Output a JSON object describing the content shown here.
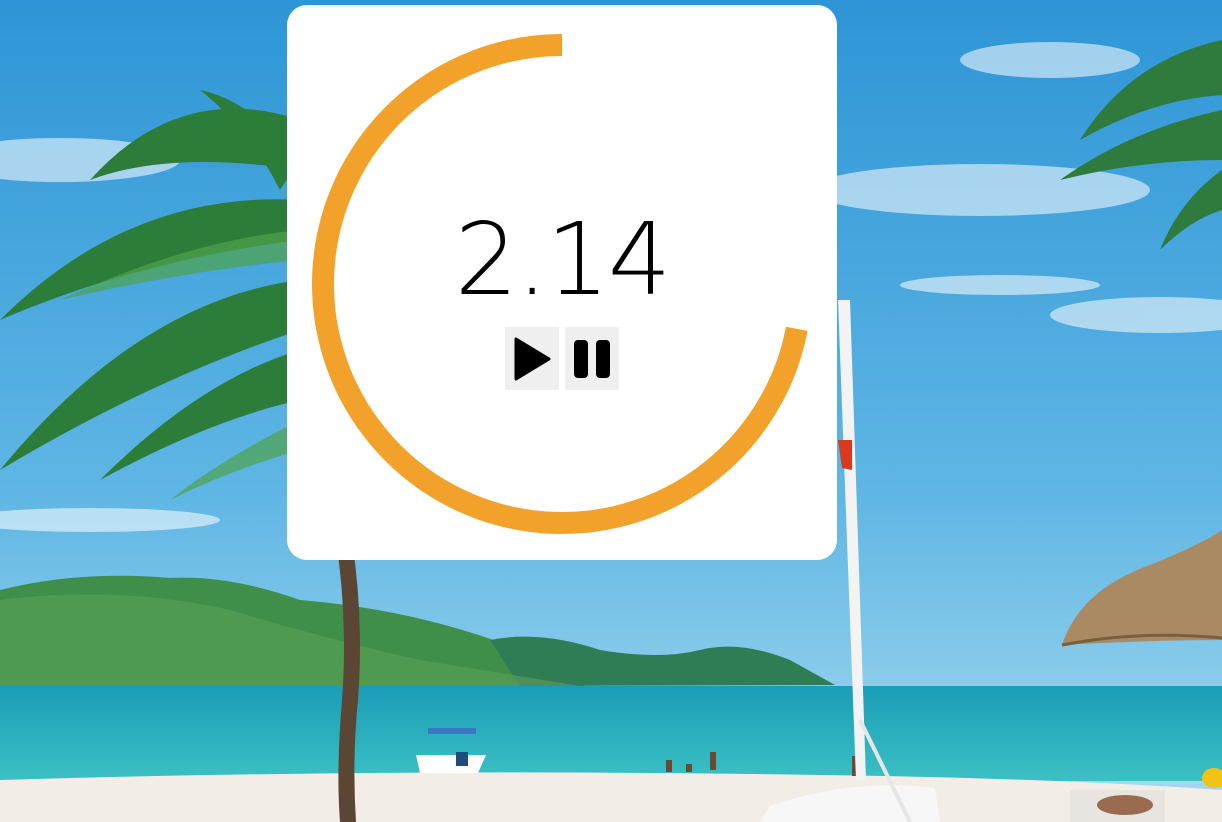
{
  "timer": {
    "value": "2.14",
    "progress": 0.72,
    "ring_color": "#f2a22b"
  },
  "controls": {
    "play_icon": "play-icon",
    "pause_icon": "pause-icon"
  },
  "background": {
    "sky_color": "#3fa3d9",
    "sea_color": "#1ea2b3",
    "sand_color": "#f1ece4"
  }
}
